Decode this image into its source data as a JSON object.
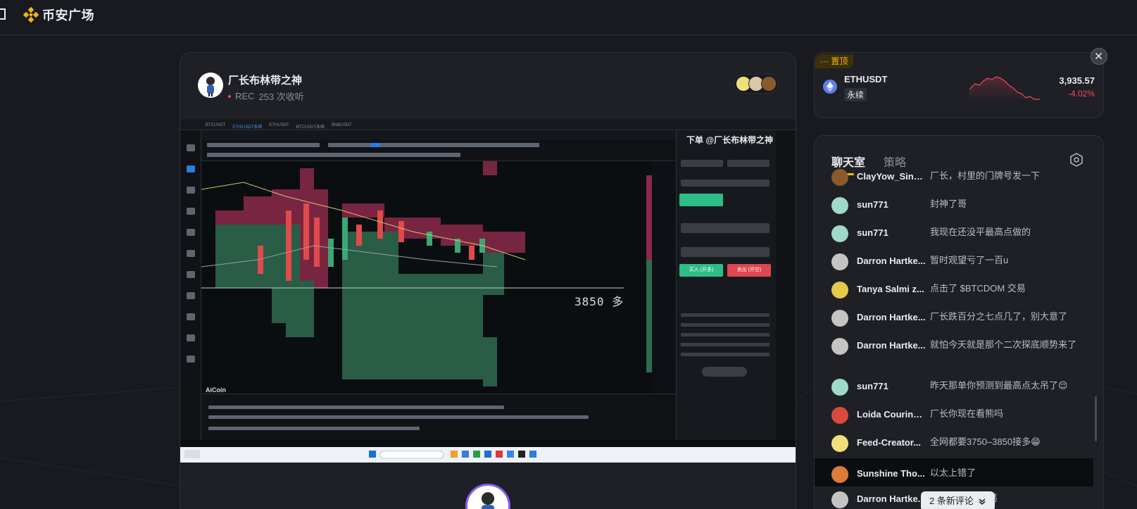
{
  "brand": {
    "name": "币安广场"
  },
  "room": {
    "host_name": "厂长布林带之神",
    "status": "REC",
    "listen_count": "253 次收听"
  },
  "screen": {
    "chart_annotation": "3850 多",
    "panel_title": "下单 @厂长布林带之神",
    "brand_watermark": "AiCoin",
    "buy_label": "买入 (开多)",
    "sell_label": "卖出 (开空)",
    "tabs": [
      "BTCUSDT",
      "ETH/USDT永续",
      "ETHUSDT",
      "BTCUSDT永续",
      "BNBUSDT"
    ]
  },
  "pinned": {
    "badge": "置顶",
    "symbol": "ETHUSDT",
    "type": "永续",
    "price": "3,935.57",
    "change": "-4.02%",
    "change_color": "#f6465d"
  },
  "chat": {
    "tabs": [
      "聊天室",
      "策略"
    ],
    "messages": [
      {
        "name": "ClayYow_Sing...",
        "text": "厂长，村里的门牌号发一下",
        "avatar_color": "#8a5a2b"
      },
      {
        "name": "sun771",
        "text": "封神了哥",
        "avatar_color": "#9fd9c8"
      },
      {
        "name": "sun771",
        "text": "我现在还没平最高点做的",
        "avatar_color": "#9fd9c8"
      },
      {
        "name": "Darron Hartke...",
        "text": "暂时观望亏了一百u",
        "avatar_color": "#c4c4c4"
      },
      {
        "name": "Tanya Salmi z...",
        "text": "点击了 $BTCDOM 交易",
        "avatar_color": "#e5c94a"
      },
      {
        "name": "Darron Hartke...",
        "text": "厂长跌百分之七点几了，别大意了",
        "avatar_color": "#c4c4c4"
      },
      {
        "name": "Darron Hartke...",
        "text": "就怕今天就是那个二次探底顺势来了",
        "avatar_color": "#c4c4c4"
      },
      {
        "name": "sun771",
        "text": "昨天那单你预测到最高点太吊了😌",
        "avatar_color": "#9fd9c8"
      },
      {
        "name": "Loida Couring...",
        "text": "厂长你现在看熊吗",
        "avatar_color": "#d94a3a"
      },
      {
        "name": "Feed-Creator...",
        "text": "全网都要3750–3850接多😁",
        "avatar_color": "#f0e07a"
      },
      {
        "name": "Sunshine Tho...",
        "text": "以太上错了",
        "avatar_color": "#e07a3a"
      },
      {
        "name": "Darron Hartke...",
        "text": "交易",
        "avatar_color": "#c4c4c4"
      }
    ],
    "new_messages": "2 条新评论"
  }
}
